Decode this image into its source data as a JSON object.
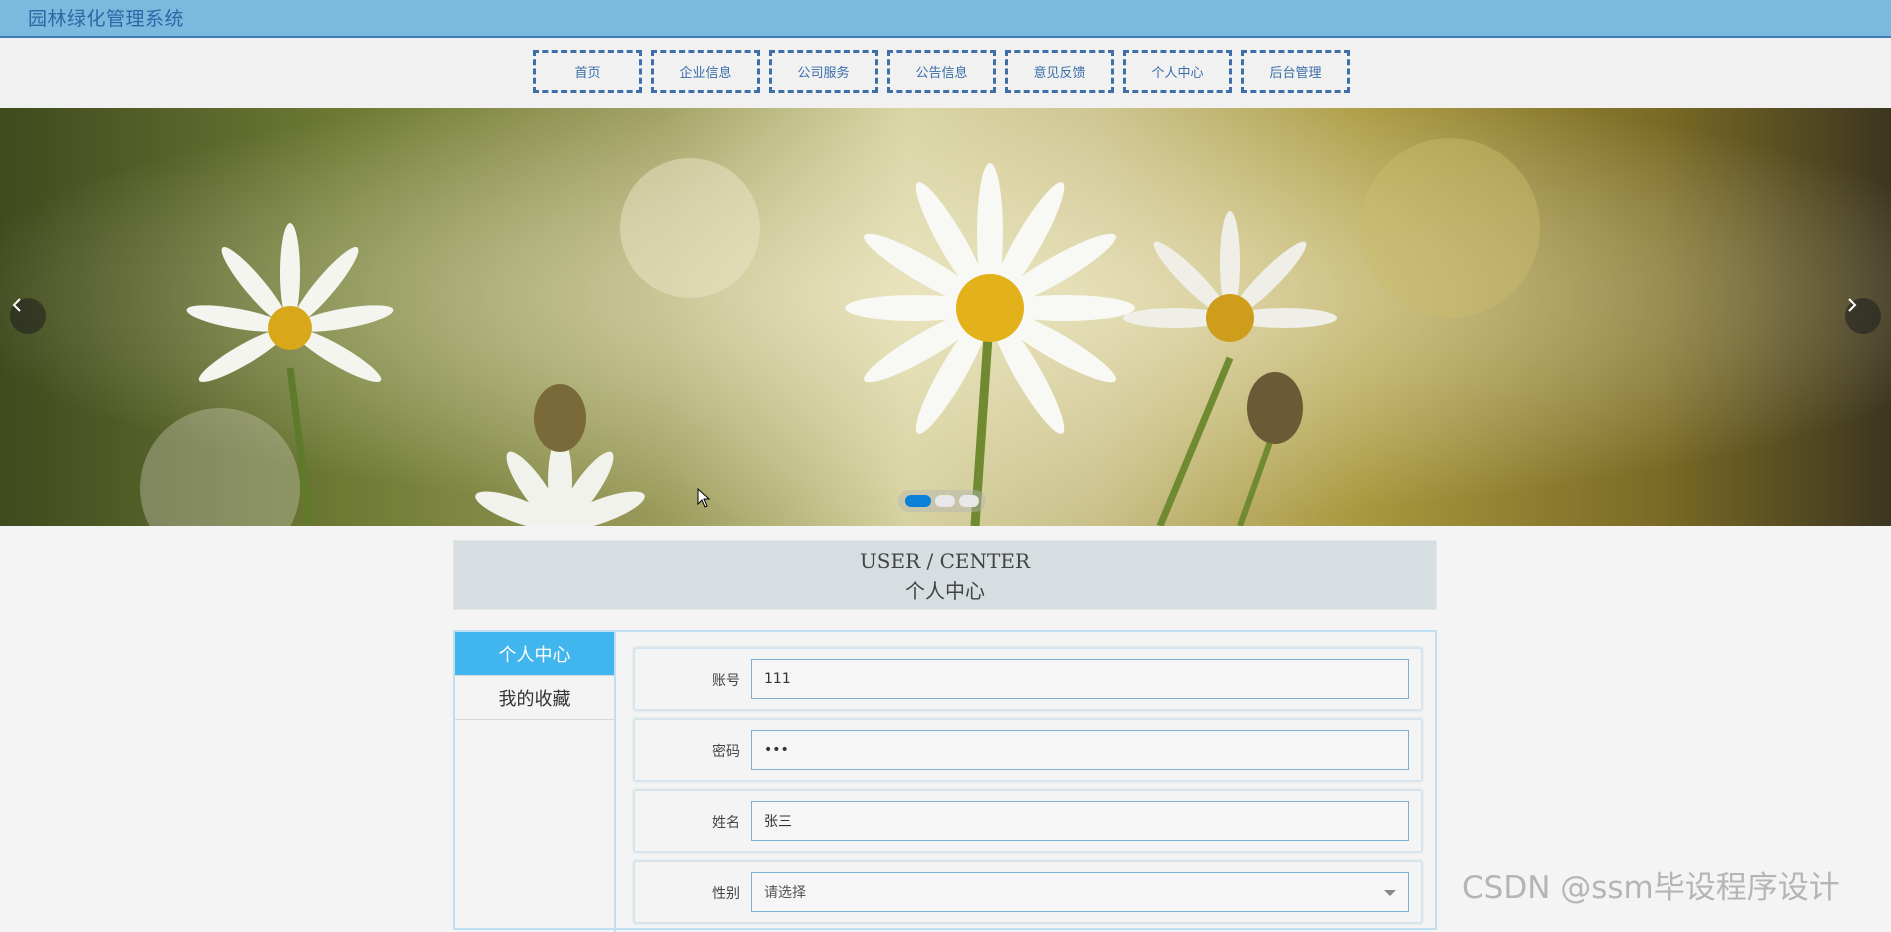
{
  "header": {
    "title": "园林绿化管理系统"
  },
  "nav": {
    "items": [
      "首页",
      "企业信息",
      "公司服务",
      "公告信息",
      "意见反馈",
      "个人中心",
      "后台管理"
    ]
  },
  "banner": {
    "active_slide": 1,
    "slide_count": 3
  },
  "section": {
    "title_en": "USER / CENTER",
    "title_cn": "个人中心"
  },
  "sidebar": {
    "items": [
      {
        "label": "个人中心",
        "active": true
      },
      {
        "label": "我的收藏",
        "active": false
      }
    ]
  },
  "form": {
    "fields": [
      {
        "label": "账号",
        "value": "111"
      },
      {
        "label": "密码",
        "value": "•••"
      },
      {
        "label": "姓名",
        "value": "张三"
      },
      {
        "label": "性别",
        "value": "请选择"
      }
    ]
  },
  "watermark": "CSDN @ssm毕设程序设计",
  "colors": {
    "header_bg": "#7bb9df",
    "nav_border": "#3f6fa8",
    "sidebar_active": "#41b5ee",
    "dot_active": "#0c7fd6"
  }
}
